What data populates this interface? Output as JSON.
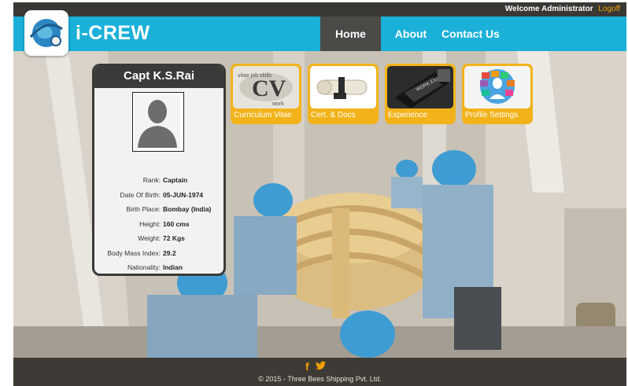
{
  "header": {
    "welcome_text": "Welcome Administrator",
    "logoff_label": "Logoff",
    "brand": "i-CREW",
    "nav": {
      "home": "Home",
      "about": "About",
      "contact": "Contact Us"
    }
  },
  "colors": {
    "nav_blue": "#1ab0d8",
    "accent_orange": "#f2b31a",
    "dark": "#3a3a38"
  },
  "profile": {
    "name": "Capt K.S.Rai",
    "fields": [
      {
        "label": "Rank:",
        "value": "Captain"
      },
      {
        "label": "Date Of Birth:",
        "value": "05-JUN-1974"
      },
      {
        "label": "Birth Place:",
        "value": "Bombay (India)"
      },
      {
        "label": "Height:",
        "value": "160 cms"
      },
      {
        "label": "Weight:",
        "value": "72 Kgs"
      },
      {
        "label": "Body Mass Index:",
        "value": "29.2"
      },
      {
        "label": "Nationality:",
        "value": "Indian"
      }
    ]
  },
  "tiles": {
    "cv": "Curriculum Vitae",
    "certs": "Cert. & Docs",
    "experience": "Experience",
    "profile_settings": "Profile Settings"
  },
  "footer": {
    "facebook_glyph": "f",
    "twitter_glyph": "🐦",
    "copyright": "© 2015 - Three Bees Shipping Pvt. Ltd."
  }
}
